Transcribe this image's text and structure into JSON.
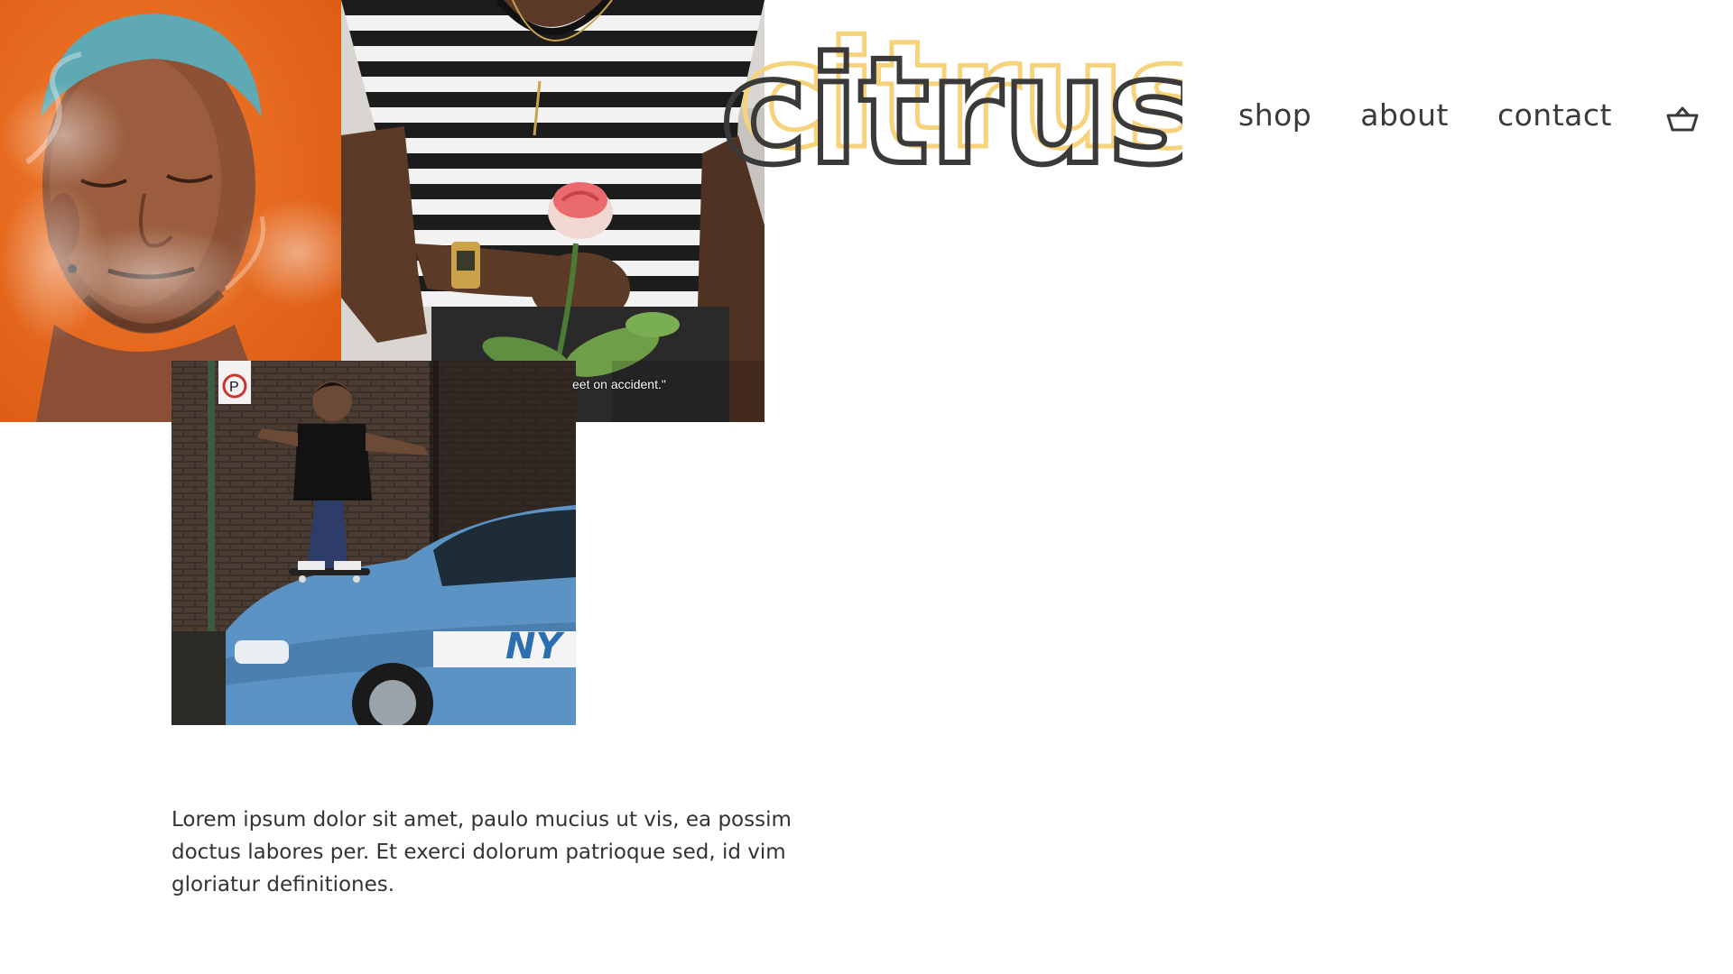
{
  "brand": {
    "logo_text": "citrus",
    "outline_color": "#3a3a3a",
    "shadow_color": "#f6d27a"
  },
  "nav": {
    "items": [
      {
        "label": "shop"
      },
      {
        "label": "about"
      },
      {
        "label": "contact"
      }
    ],
    "cart_icon": "basket-icon"
  },
  "photos": {
    "rose_caption": "eet on accident.\""
  },
  "content": {
    "paragraph": "Lorem ipsum dolor sit amet, paulo mucius ut vis, ea possim doctus labores per. Et exerci dolorum patrioque sed, id vim gloriatur definitiones."
  },
  "colors": {
    "text": "#333333",
    "background": "#ffffff",
    "orange": "#e8641e"
  }
}
